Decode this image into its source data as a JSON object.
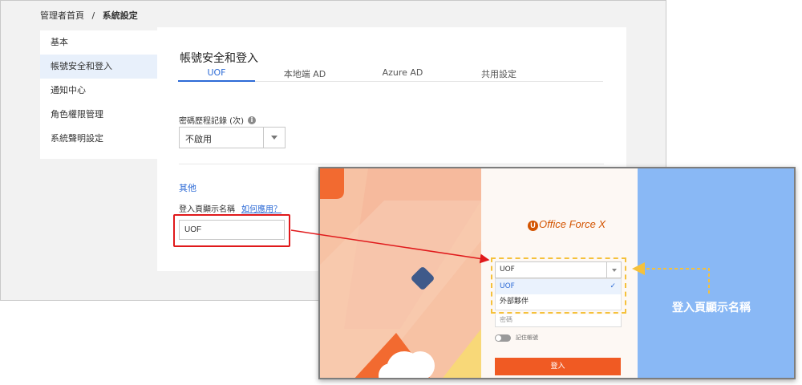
{
  "breadcrumb": {
    "home": "管理者首頁",
    "separator": "/",
    "current": "系統設定"
  },
  "sidebar": {
    "items": [
      {
        "label": "基本"
      },
      {
        "label": "帳號安全和登入"
      },
      {
        "label": "通知中心"
      },
      {
        "label": "角色權限管理"
      },
      {
        "label": "系統聲明設定"
      }
    ],
    "active_index": 1
  },
  "main": {
    "title": "帳號安全和登入",
    "tabs": [
      {
        "label": "UOF"
      },
      {
        "label": "本地端 AD"
      },
      {
        "label": "Azure AD"
      },
      {
        "label": "共用設定"
      }
    ],
    "active_tab": 0,
    "password_history": {
      "label": "密碼歷程記錄 (次)",
      "value": "不啟用"
    },
    "other_section": {
      "title": "其他",
      "login_display_label": "登入頁顯示名稱",
      "howto_link": "如何應用？",
      "login_display_value": "UOF"
    }
  },
  "preview": {
    "logo": {
      "mark": "U",
      "text": "Office Force X"
    },
    "select_value": "UOF",
    "dropdown_options": [
      {
        "label": "UOF",
        "selected": true
      },
      {
        "label": "外部夥伴",
        "selected": false
      }
    ],
    "password_placeholder": "密碼",
    "remember_label": "記住帳號",
    "login_button": "登入",
    "callout_label": "登入頁顯示名稱"
  },
  "colors": {
    "accent_blue": "#2d6bd6",
    "highlight_red": "#e0191b",
    "dash_yellow": "#f5c13b",
    "login_orange": "#f05a23",
    "preview_blue": "#89b8f5",
    "preview_peach": "#f7c2a4"
  },
  "icons": [
    "info-icon",
    "chevron-down-icon",
    "check-icon",
    "arrow-connector-icon"
  ]
}
